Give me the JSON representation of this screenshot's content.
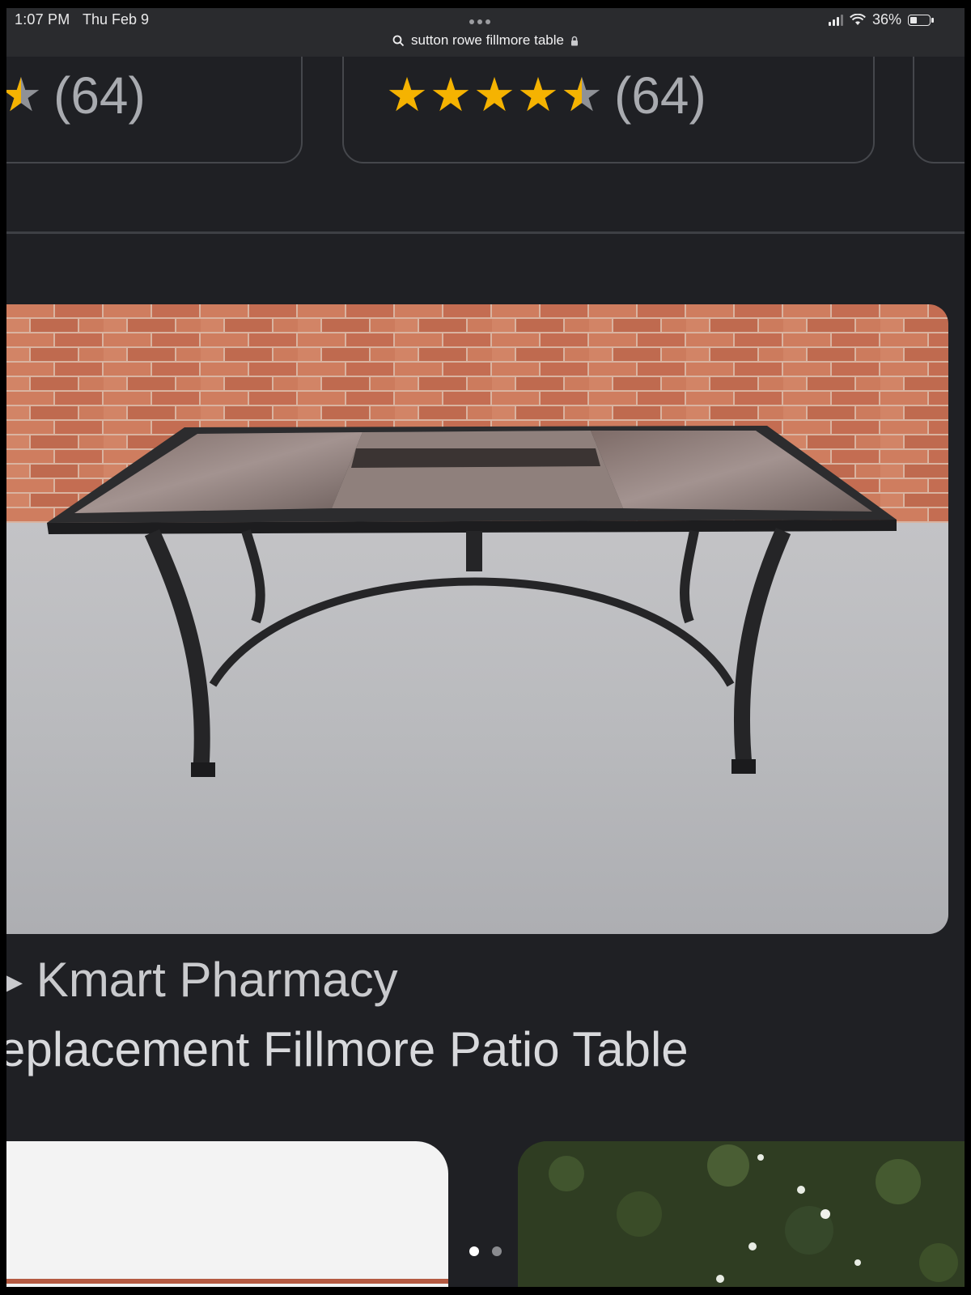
{
  "status_bar": {
    "time": "1:07 PM",
    "date": "Thu Feb 9",
    "battery": "36%",
    "icons": [
      "signal-icon",
      "wifi-icon",
      "battery-icon"
    ]
  },
  "browser": {
    "url_text": "sutton rowe fillmore table",
    "search_icon": "search-icon",
    "lock_icon": "lock-icon"
  },
  "rating_cards": [
    {
      "rating": 4.5,
      "count": "(64)"
    },
    {
      "rating": 4.5,
      "count": "(64)"
    }
  ],
  "result": {
    "store": "Kmart Pharmacy",
    "title": "eplacement Fillmore Patio Table"
  },
  "carousel": {
    "pages": 2,
    "active_index": 0
  },
  "colors": {
    "background": "#1f2024",
    "star": "#f5b301",
    "text": "#d8d9dc",
    "muted": "#a9abb0"
  }
}
